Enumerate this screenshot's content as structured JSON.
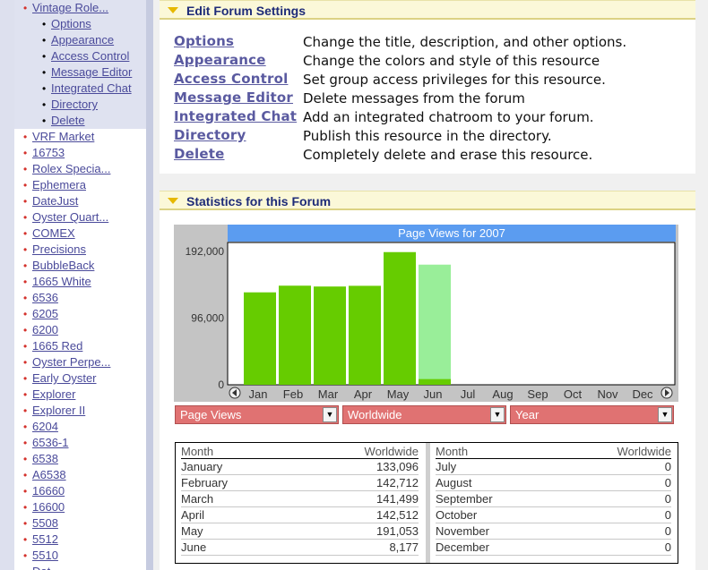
{
  "sidebar": {
    "current_forum": "Vintage Role...",
    "sub_items": [
      "Options",
      "Appearance",
      "Access Control",
      "Message Editor",
      "Integrated Chat",
      "Directory",
      "Delete"
    ],
    "forums": [
      "VRF Market",
      "16753",
      "Rolex Specia...",
      "Ephemera",
      "DateJust",
      "Oyster Quart...",
      "COMEX",
      "Precisions",
      "BubbleBack",
      "1665 White",
      "6536",
      "6205",
      "6200",
      "1665 Red",
      "Oyster Perpe...",
      "Early Oyster",
      "Explorer",
      "Explorer II",
      "6204",
      "6536-1",
      "6538",
      "A6538",
      "16660 ",
      "16600",
      "5508",
      "5512",
      "5510",
      "Dat..."
    ]
  },
  "edit_panel": {
    "title": "Edit Forum Settings",
    "options": [
      {
        "label": "Options",
        "desc": "Change the title, description, and other options."
      },
      {
        "label": "Appearance",
        "desc": "Change the colors and style of this resource"
      },
      {
        "label": "Access Control",
        "desc": "Set group access privileges for this resource."
      },
      {
        "label": "Message Editor",
        "desc": "Delete messages from the forum"
      },
      {
        "label": "Integrated Chat",
        "desc": "Add an integrated chatroom to your forum."
      },
      {
        "label": "Directory",
        "desc": "Publish this resource in the directory."
      },
      {
        "label": "Delete",
        "desc": "Completely delete and erase this resource."
      }
    ]
  },
  "stats_panel": {
    "title": "Statistics for this Forum",
    "filters": [
      "Page Views",
      "Worldwide",
      "Year"
    ],
    "table": {
      "col_month": "Month",
      "col_value": "Worldwide",
      "rows": [
        {
          "month": "January",
          "value": "133,096"
        },
        {
          "month": "February",
          "value": "142,712"
        },
        {
          "month": "March",
          "value": "141,499"
        },
        {
          "month": "April",
          "value": "142,512"
        },
        {
          "month": "May",
          "value": "191,053"
        },
        {
          "month": "June",
          "value": "8,177"
        },
        {
          "month": "July",
          "value": "0"
        },
        {
          "month": "August",
          "value": "0"
        },
        {
          "month": "September",
          "value": "0"
        },
        {
          "month": "October",
          "value": "0"
        },
        {
          "month": "November",
          "value": "0"
        },
        {
          "month": "December",
          "value": "0"
        }
      ]
    }
  },
  "chart_data": {
    "type": "bar",
    "title": "Page Views for 2007",
    "categories": [
      "Jan",
      "Feb",
      "Mar",
      "Apr",
      "May",
      "Jun",
      "Jul",
      "Aug",
      "Sep",
      "Oct",
      "Nov",
      "Dec"
    ],
    "series": [
      {
        "values": [
          133096,
          142712,
          141499,
          142512,
          191053,
          8177,
          0,
          0,
          0,
          0,
          0,
          0
        ],
        "color": "#66cc00"
      },
      {
        "values": [
          null,
          null,
          null,
          null,
          null,
          173000,
          null,
          null,
          null,
          null,
          null,
          null
        ],
        "color": "#99ee99"
      }
    ],
    "ytick_labels": [
      "192,000",
      "96,000",
      "0"
    ],
    "yticks": [
      192000,
      96000,
      0
    ],
    "ylim": [
      0,
      192000
    ],
    "colors": {
      "title_bg": "#5b9cf0",
      "plot_bg": "#ffffff",
      "frame_bg": "#c4c4c4"
    }
  }
}
